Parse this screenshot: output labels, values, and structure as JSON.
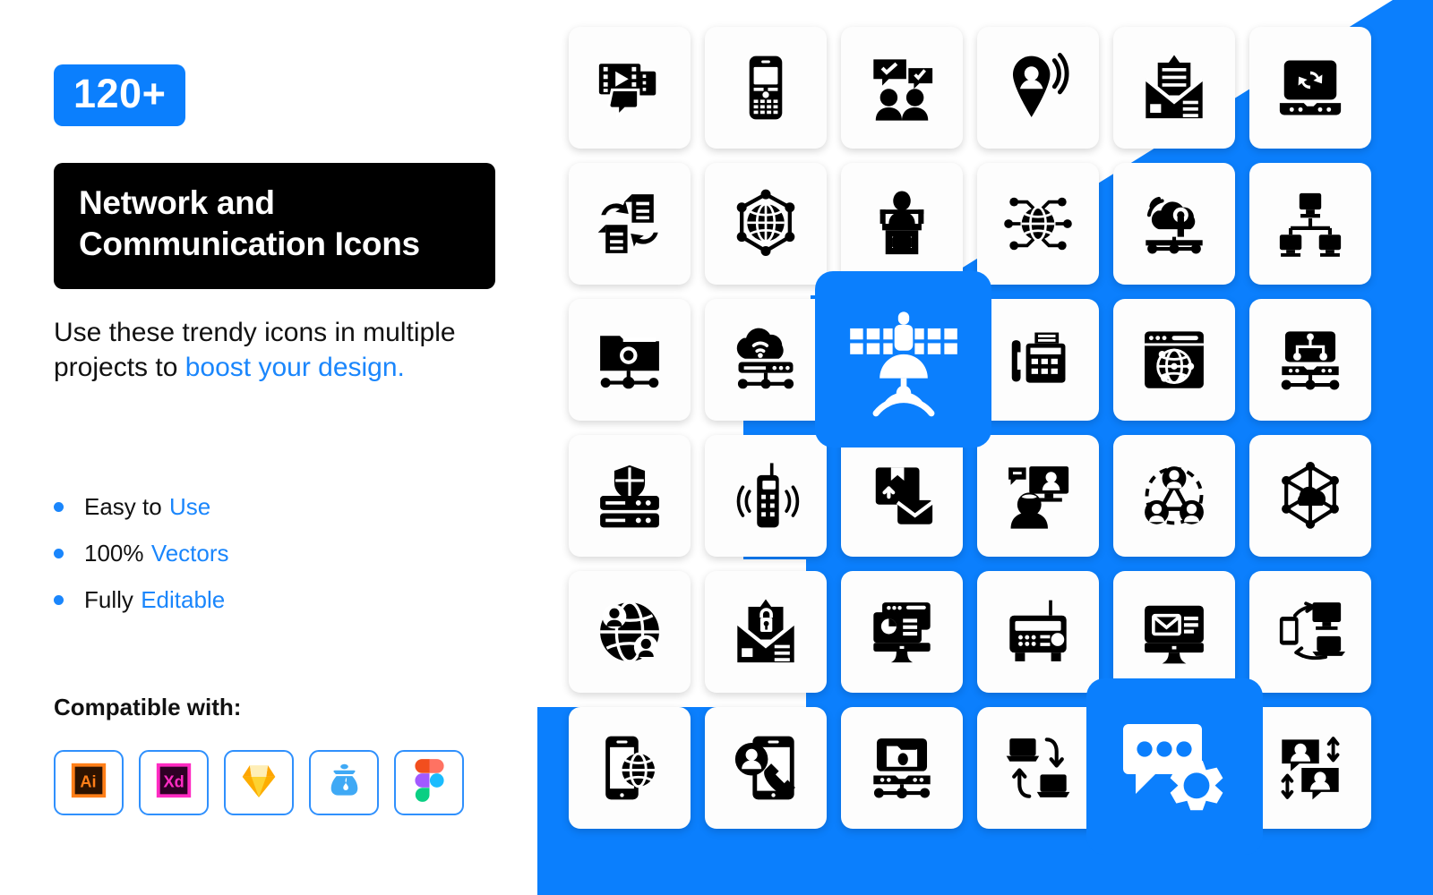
{
  "promo": {
    "badge": "120+",
    "title_line1": "Network and",
    "title_line2": "Communication Icons",
    "desc_part1": "Use these trendy icons in multiple projects to ",
    "desc_highlight": "boost your design.",
    "bullets": [
      {
        "plain": "Easy to",
        "highlight": "Use"
      },
      {
        "plain": "100%",
        "highlight": "Vectors"
      },
      {
        "plain": "Fully",
        "highlight": "Editable"
      }
    ],
    "compatible_label": "Compatible with:",
    "apps": [
      {
        "name": "adobe-illustrator",
        "label": "Ai"
      },
      {
        "name": "adobe-xd",
        "label": "Xd"
      },
      {
        "name": "sketch",
        "label": "Sketch"
      },
      {
        "name": "inkscape",
        "label": "Inkscape"
      },
      {
        "name": "figma",
        "label": "Figma"
      }
    ]
  },
  "colors": {
    "accent_blue": "#0b7ffd",
    "text_blue": "#1a86fc",
    "title_bg": "#000000",
    "tile_bg": "#fdfdfd",
    "icon": "#000000"
  },
  "grid": {
    "columns": 6,
    "rows": 6,
    "icons": [
      "video-message-icon",
      "mobile-phone-icon",
      "group-chat-approved-icon",
      "location-signal-icon",
      "open-mail-icon",
      "laptop-sync-icon",
      "document-exchange-icon",
      "global-network-icon",
      "speaker-podium-icon",
      "globe-nodes-icon",
      "cloud-wifi-server-icon",
      "computer-network-icon",
      "folder-network-icon",
      "cloud-wifi-router-icon",
      "satellite-signal-icon",
      "fax-machine-icon",
      "browser-globe-icon",
      "server-hierarchy-icon",
      "server-shield-icon",
      "walkie-talkie-icon",
      "parcel-mail-icon",
      "video-conference-icon",
      "team-connection-icon",
      "cloud-hexagon-network-icon",
      "global-users-icon",
      "secure-mail-icon",
      "desktop-analytics-icon",
      "radio-receiver-icon",
      "desktop-mail-icon",
      "device-sync-icon",
      "mobile-globe-icon",
      "tablet-call-icon",
      "server-folder-icon",
      "data-transfer-icon",
      "chat-settings-icon",
      "chat-user-exchange-icon"
    ],
    "featured": [
      {
        "name": "satellite-signal-icon",
        "row": 3,
        "col": 3
      },
      {
        "name": "chat-settings-icon",
        "row": 6,
        "col": 5
      }
    ]
  }
}
